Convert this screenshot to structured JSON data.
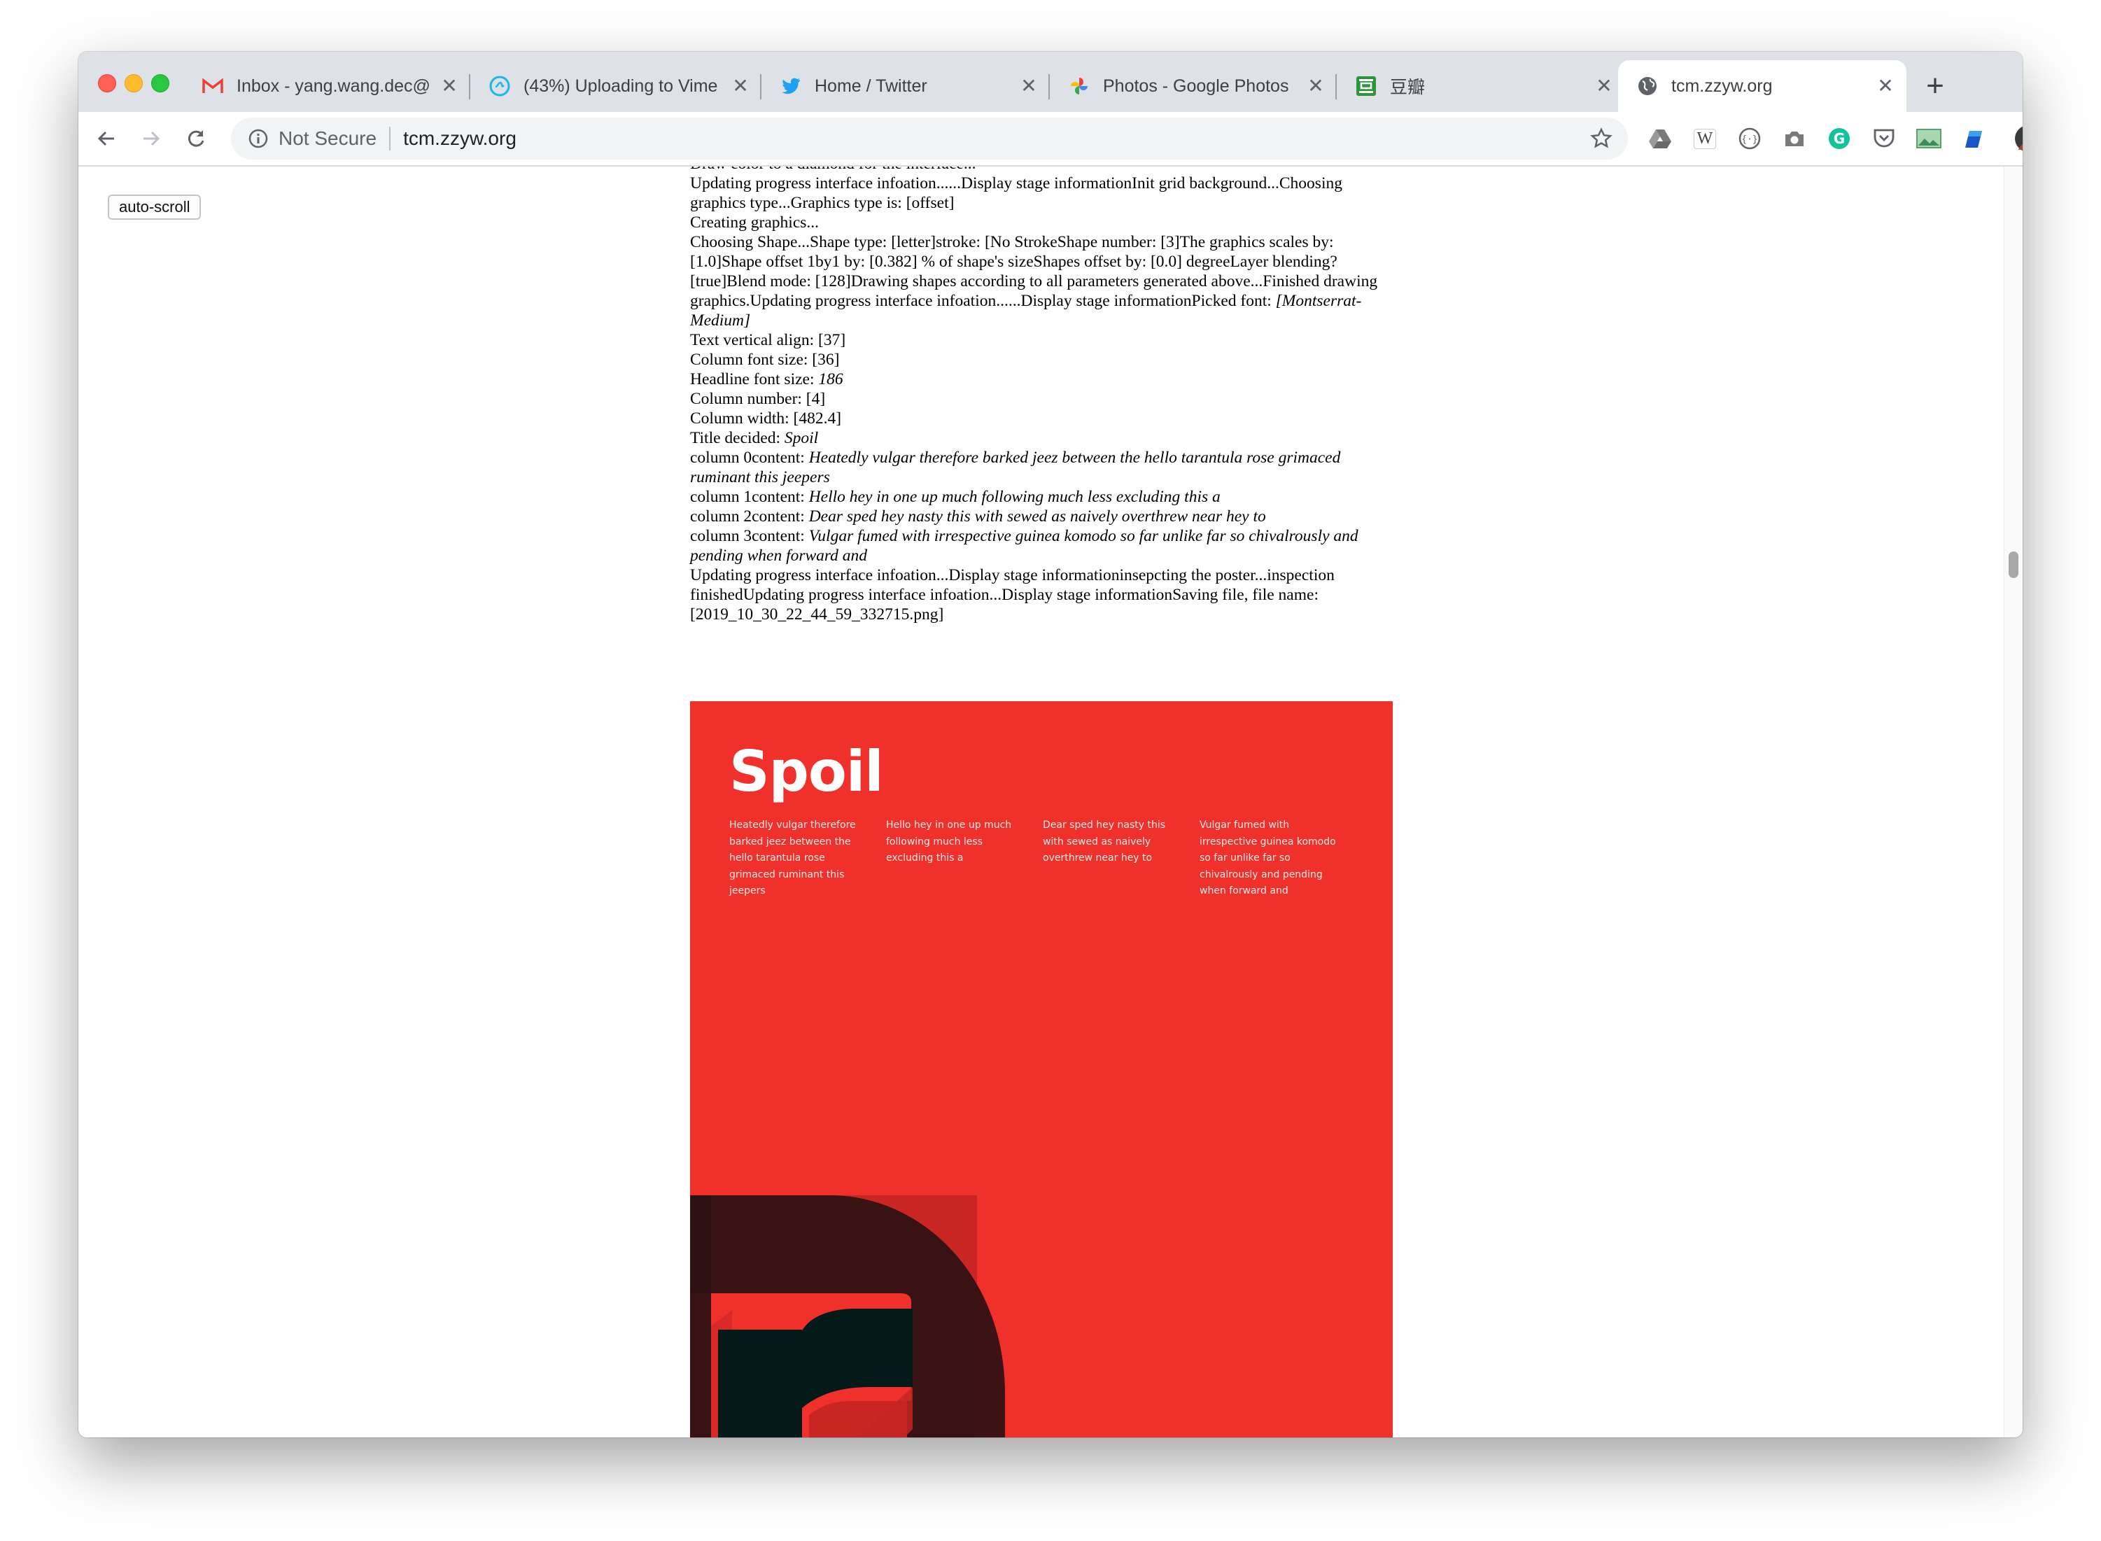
{
  "tabs": [
    {
      "title": "Inbox - yang.wang.dec@",
      "icon": "gmail-icon"
    },
    {
      "title": "(43%) Uploading to Vime",
      "icon": "vimeo-upload-icon"
    },
    {
      "title": "Home / Twitter",
      "icon": "twitter-icon"
    },
    {
      "title": "Photos - Google Photos",
      "icon": "google-photos-icon"
    },
    {
      "title": "豆瓣",
      "icon": "douban-icon"
    },
    {
      "title": "tcm.zzyw.org",
      "icon": "globe-icon",
      "active": true
    }
  ],
  "omnibox": {
    "security": "Not Secure",
    "url": "tcm.zzyw.org"
  },
  "page": {
    "autoscroll_label": "auto-scroll",
    "log": {
      "l0": "Draw color to a diamond for the interface...",
      "l1": "Updating progress interface infoation......Display stage informationInit grid background...Choosing graphics type...Graphics type is: [offset]",
      "l2": "Creating graphics...",
      "l3": "Choosing Shape...Shape type: [letter]stroke: [No StrokeShape number: [3]The graphics scales by: [1.0]Shape offset 1by1 by: [0.382] % of shape's sizeShapes offset by: [0.0] degreeLayer blending?[true]Blend mode: [128]Drawing shapes according to all parameters generated above...Finished drawing graphics.Updating progress interface infoation......Display stage informationPicked font: ",
      "l3_font": "[Montserrat-Medium]",
      "l4": "Text vertical align: [37]",
      "l5": "Column font size: [36]",
      "l6_label": "Headline font size: ",
      "l6_value": "186",
      "l7": "Column number: [4]",
      "l8": "Column width: [482.4]",
      "l9_label": "Title decided: ",
      "l9_value": "Spoil",
      "c0_label": "column 0content: ",
      "c0_value": "Heatedly vulgar therefore barked jeez between the hello tarantula rose grimaced ruminant this jeepers",
      "c1_label": "column 1content: ",
      "c1_value": "Hello hey in one up much following much less excluding this a",
      "c2_label": "column 2content: ",
      "c2_value": "Dear sped hey nasty this with sewed as naively overthrew near hey to",
      "c3_label": "column 3content: ",
      "c3_value": "Vulgar fumed with irrespective guinea komodo so far unlike far so chivalrously and pending when forward and",
      "l10": "Updating progress interface infoation...Display stage informationinsepcting the poster...inspection finishedUpdating progress interface infoation...Display stage informationSaving file, file name: [2019_10_30_22_44_59_332715.png]"
    },
    "poster": {
      "title": "Spoil",
      "columns": [
        "Heatedly vulgar therefore barked jeez between the hello tarantula rose grimaced ruminant this jeepers",
        "Hello hey in one up much following much less excluding this a",
        "Dear sped hey nasty this with sewed as naively overthrew near hey to",
        "Vulgar fumed with irrespective guinea komodo so far unlike far so chivalrously and pending when forward and"
      ],
      "background": "#f0302b"
    }
  },
  "colors": {
    "tabstrip": "#dee1e6",
    "accent_blue": "#1a73e8"
  }
}
